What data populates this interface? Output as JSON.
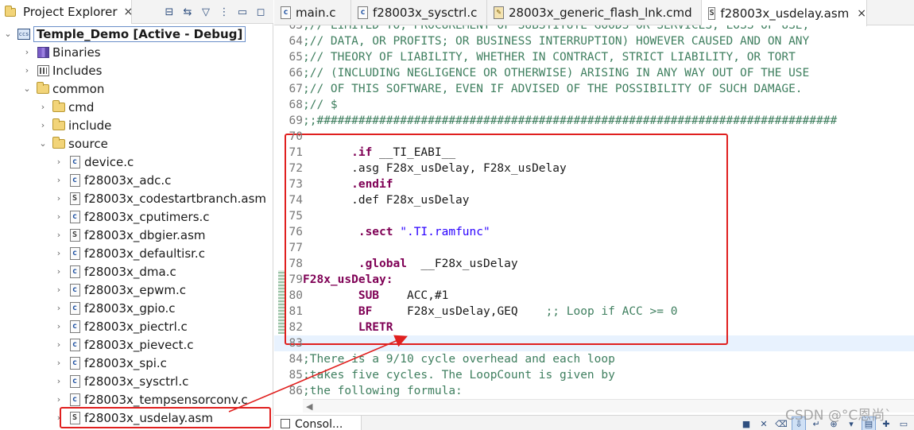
{
  "explorer": {
    "title": "Project Explorer",
    "close": "×",
    "tree": [
      {
        "label": "Temple_Demo  [Active - Debug]",
        "level": 0,
        "expanded": true,
        "icon": "project-icon",
        "kind": "project"
      },
      {
        "label": "Binaries",
        "level": 1,
        "expanded": false,
        "icon": "binaries-icon",
        "kind": "bin"
      },
      {
        "label": "Includes",
        "level": 1,
        "expanded": false,
        "icon": "includes-icon",
        "kind": "inc"
      },
      {
        "label": "common",
        "level": 1,
        "expanded": true,
        "icon": "folder-icon",
        "kind": "folder"
      },
      {
        "label": "cmd",
        "level": 2,
        "expanded": false,
        "icon": "folder-icon",
        "kind": "folder"
      },
      {
        "label": "include",
        "level": 2,
        "expanded": false,
        "icon": "folder-icon",
        "kind": "folder"
      },
      {
        "label": "source",
        "level": 2,
        "expanded": true,
        "icon": "folder-icon",
        "kind": "folder"
      },
      {
        "label": "device.c",
        "level": 3,
        "expanded": false,
        "icon": "c-file-icon",
        "kind": "c"
      },
      {
        "label": "f28003x_adc.c",
        "level": 3,
        "expanded": false,
        "icon": "c-file-icon",
        "kind": "c"
      },
      {
        "label": "f28003x_codestartbranch.asm",
        "level": 3,
        "expanded": false,
        "icon": "asm-file-icon",
        "kind": "s"
      },
      {
        "label": "f28003x_cputimers.c",
        "level": 3,
        "expanded": false,
        "icon": "c-file-icon",
        "kind": "c"
      },
      {
        "label": "f28003x_dbgier.asm",
        "level": 3,
        "expanded": false,
        "icon": "asm-file-icon",
        "kind": "s"
      },
      {
        "label": "f28003x_defaultisr.c",
        "level": 3,
        "expanded": false,
        "icon": "c-file-icon",
        "kind": "c"
      },
      {
        "label": "f28003x_dma.c",
        "level": 3,
        "expanded": false,
        "icon": "c-file-icon",
        "kind": "c"
      },
      {
        "label": "f28003x_epwm.c",
        "level": 3,
        "expanded": false,
        "icon": "c-file-icon",
        "kind": "c"
      },
      {
        "label": "f28003x_gpio.c",
        "level": 3,
        "expanded": false,
        "icon": "c-file-icon",
        "kind": "c"
      },
      {
        "label": "f28003x_piectrl.c",
        "level": 3,
        "expanded": false,
        "icon": "c-file-icon",
        "kind": "c"
      },
      {
        "label": "f28003x_pievect.c",
        "level": 3,
        "expanded": false,
        "icon": "c-file-icon",
        "kind": "c"
      },
      {
        "label": "f28003x_spi.c",
        "level": 3,
        "expanded": false,
        "icon": "c-file-icon",
        "kind": "c"
      },
      {
        "label": "f28003x_sysctrl.c",
        "level": 3,
        "expanded": false,
        "icon": "c-file-icon",
        "kind": "c"
      },
      {
        "label": "f28003x_tempsensorconv.c",
        "level": 3,
        "expanded": false,
        "icon": "c-file-icon",
        "kind": "c"
      },
      {
        "label": "f28003x_usdelay.asm",
        "level": 3,
        "expanded": false,
        "icon": "asm-file-icon",
        "kind": "s"
      }
    ]
  },
  "editor": {
    "tabs": [
      {
        "label": "main.c",
        "icon": "c-file-icon",
        "kind": "c"
      },
      {
        "label": "f28003x_sysctrl.c",
        "icon": "c-file-icon",
        "kind": "c"
      },
      {
        "label": "28003x_generic_flash_lnk.cmd",
        "icon": "cmd-file-icon",
        "kind": "cmd"
      },
      {
        "label": "f28003x_usdelay.asm",
        "icon": "asm-file-icon",
        "kind": "s",
        "active": true,
        "close": "×"
      }
    ],
    "lines": [
      {
        "n": "63",
        "parts": [
          {
            "t": ";// LIMITED TO, PROCUREMENT OF SUBSTITUTE GOODS OR SERVICES; LOSS OF USE,",
            "c": "cmt"
          }
        ]
      },
      {
        "n": "64",
        "parts": [
          {
            "t": ";// DATA, OR PROFITS; OR BUSINESS INTERRUPTION) HOWEVER CAUSED AND ON ANY",
            "c": "cmt"
          }
        ]
      },
      {
        "n": "65",
        "parts": [
          {
            "t": ";// THEORY OF LIABILITY, WHETHER IN CONTRACT, STRICT LIABILITY, OR TORT",
            "c": "cmt"
          }
        ]
      },
      {
        "n": "66",
        "parts": [
          {
            "t": ";// (INCLUDING NEGLIGENCE OR OTHERWISE) ARISING IN ANY WAY OUT OF THE USE",
            "c": "cmt"
          }
        ]
      },
      {
        "n": "67",
        "parts": [
          {
            "t": ";// OF THIS SOFTWARE, EVEN IF ADVISED OF THE POSSIBILITY OF SUCH DAMAGE.",
            "c": "cmt"
          }
        ]
      },
      {
        "n": "68",
        "parts": [
          {
            "t": ";// $",
            "c": "cmt"
          }
        ]
      },
      {
        "n": "69",
        "parts": [
          {
            "t": ";;###########################################################################",
            "c": "cmt"
          }
        ]
      },
      {
        "n": "70",
        "parts": []
      },
      {
        "n": "71",
        "parts": [
          {
            "t": "       ",
            "c": "txt"
          },
          {
            "t": ".if",
            "c": "kw"
          },
          {
            "t": " __TI_EABI__",
            "c": "txt"
          }
        ]
      },
      {
        "n": "72",
        "parts": [
          {
            "t": "       .asg F28x_usDelay, F28x_usDelay",
            "c": "txt"
          }
        ]
      },
      {
        "n": "73",
        "parts": [
          {
            "t": "       ",
            "c": "txt"
          },
          {
            "t": ".endif",
            "c": "kw"
          }
        ]
      },
      {
        "n": "74",
        "parts": [
          {
            "t": "       .def F28x_usDelay",
            "c": "txt"
          }
        ]
      },
      {
        "n": "75",
        "parts": []
      },
      {
        "n": "76",
        "parts": [
          {
            "t": "        ",
            "c": "txt"
          },
          {
            "t": ".sect",
            "c": "kw"
          },
          {
            "t": " ",
            "c": "txt"
          },
          {
            "t": "\".TI.ramfunc\"",
            "c": "str"
          }
        ]
      },
      {
        "n": "77",
        "parts": []
      },
      {
        "n": "78",
        "parts": [
          {
            "t": "        ",
            "c": "txt"
          },
          {
            "t": ".global",
            "c": "kw"
          },
          {
            "t": "  __F28x_usDelay",
            "c": "txt"
          }
        ]
      },
      {
        "n": "79",
        "parts": [
          {
            "t": "F28x_usDelay:",
            "c": "kw"
          }
        ]
      },
      {
        "n": "80",
        "parts": [
          {
            "t": "        ",
            "c": "txt"
          },
          {
            "t": "SUB",
            "c": "kw"
          },
          {
            "t": "    ACC,#1",
            "c": "txt"
          }
        ]
      },
      {
        "n": "81",
        "parts": [
          {
            "t": "        ",
            "c": "txt"
          },
          {
            "t": "BF",
            "c": "kw"
          },
          {
            "t": "     F28x_usDelay,GEQ    ",
            "c": "txt"
          },
          {
            "t": ";; Loop if ACC >= 0",
            "c": "cmt"
          }
        ]
      },
      {
        "n": "82",
        "parts": [
          {
            "t": "        ",
            "c": "txt"
          },
          {
            "t": "LRETR",
            "c": "kw"
          }
        ]
      },
      {
        "n": "83",
        "parts": []
      },
      {
        "n": "84",
        "parts": [
          {
            "t": ";There is a 9/10 cycle overhead and each loop",
            "c": "cmt"
          }
        ]
      },
      {
        "n": "85",
        "parts": [
          {
            "t": ";takes five cycles. The LoopCount is given by",
            "c": "cmt"
          }
        ]
      },
      {
        "n": "86",
        "parts": [
          {
            "t": ";the following formula:",
            "c": "cmt"
          }
        ]
      }
    ]
  },
  "bottom": {
    "tab_label": "Consol..."
  },
  "watermark": "CSDN @°C恩尚`",
  "colors": {
    "annotation": "#e0201f",
    "comment": "#3f7f5f",
    "keyword": "#7f0055",
    "string": "#2a00ff"
  }
}
